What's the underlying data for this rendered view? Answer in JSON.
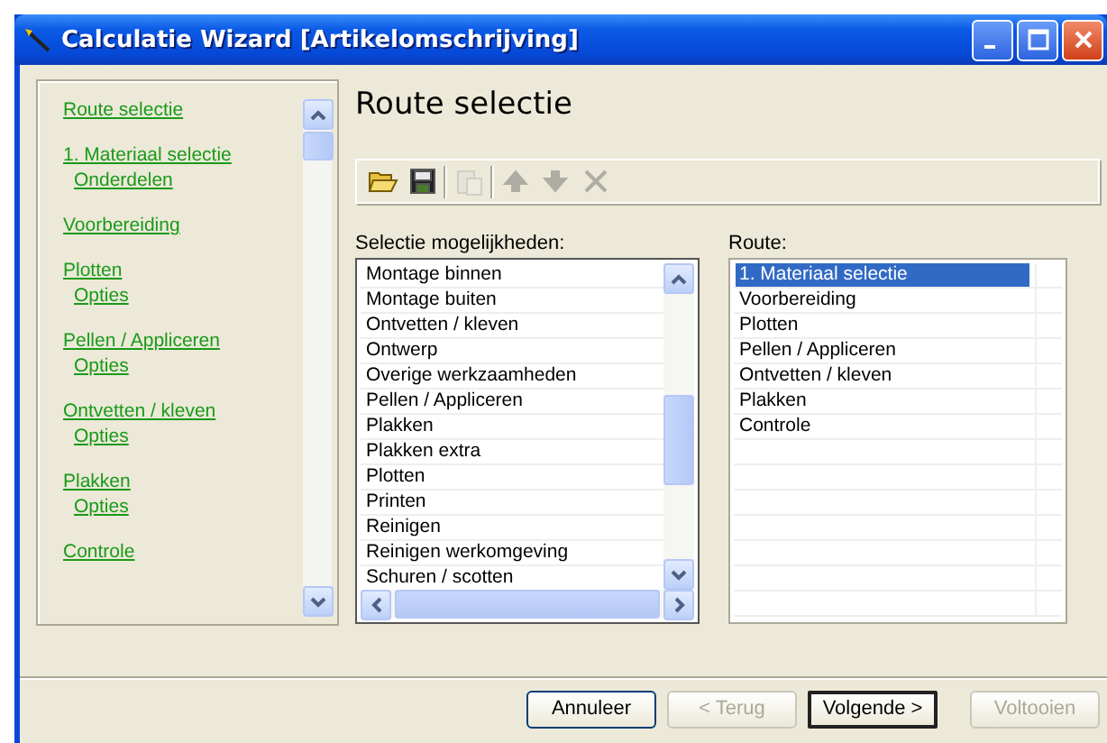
{
  "window": {
    "title": "Calculatie Wizard [Artikelomschrijving]"
  },
  "sidebar": {
    "items": [
      {
        "label": "Route selectie"
      },
      {
        "label": "1. Materiaal selectie",
        "children": [
          {
            "label": "Onderdelen"
          }
        ]
      },
      {
        "label": "Voorbereiding"
      },
      {
        "label": "Plotten",
        "children": [
          {
            "label": "Opties"
          }
        ]
      },
      {
        "label": "Pellen / Appliceren",
        "children": [
          {
            "label": "Opties"
          }
        ]
      },
      {
        "label": "Ontvetten / kleven",
        "children": [
          {
            "label": "Opties"
          }
        ]
      },
      {
        "label": "Plakken",
        "children": [
          {
            "label": "Opties"
          }
        ]
      },
      {
        "label": "Controle"
      }
    ]
  },
  "page": {
    "heading": "Route selectie"
  },
  "toolbar": [
    {
      "disabled": false
    },
    {
      "disabled": false
    },
    {
      "disabled": true
    },
    {
      "disabled": true
    },
    {
      "disabled": true
    },
    {
      "disabled": true
    }
  ],
  "options": {
    "label": "Selectie mogelijkheden:",
    "items": [
      {
        "label": "Montage binnen"
      },
      {
        "label": "Montage buiten"
      },
      {
        "label": "Ontvetten / kleven"
      },
      {
        "label": "Ontwerp"
      },
      {
        "label": "Overige werkzaamheden"
      },
      {
        "label": "Pellen / Appliceren"
      },
      {
        "label": "Plakken"
      },
      {
        "label": "Plakken extra"
      },
      {
        "label": "Plotten"
      },
      {
        "label": "Printen"
      },
      {
        "label": "Reinigen"
      },
      {
        "label": "Reinigen werkomgeving"
      },
      {
        "label": "Schuren / scotten"
      }
    ]
  },
  "route": {
    "label": "Route:",
    "items": [
      {
        "label": "1. Materiaal selectie",
        "selected": true
      },
      {
        "label": "Voorbereiding",
        "selected": false
      },
      {
        "label": "Plotten",
        "selected": false
      },
      {
        "label": "Pellen / Appliceren",
        "selected": false
      },
      {
        "label": "Ontvetten / kleven",
        "selected": false
      },
      {
        "label": "Plakken",
        "selected": false
      },
      {
        "label": "Controle",
        "selected": false
      }
    ]
  },
  "buttons": [
    {
      "label": "Annuleer",
      "disabled": false,
      "default": false
    },
    {
      "label": "< Terug",
      "disabled": true,
      "default": false
    },
    {
      "label": "Volgende >",
      "disabled": false,
      "default": true
    },
    {
      "label": "Voltooien",
      "disabled": true,
      "default": false
    }
  ]
}
